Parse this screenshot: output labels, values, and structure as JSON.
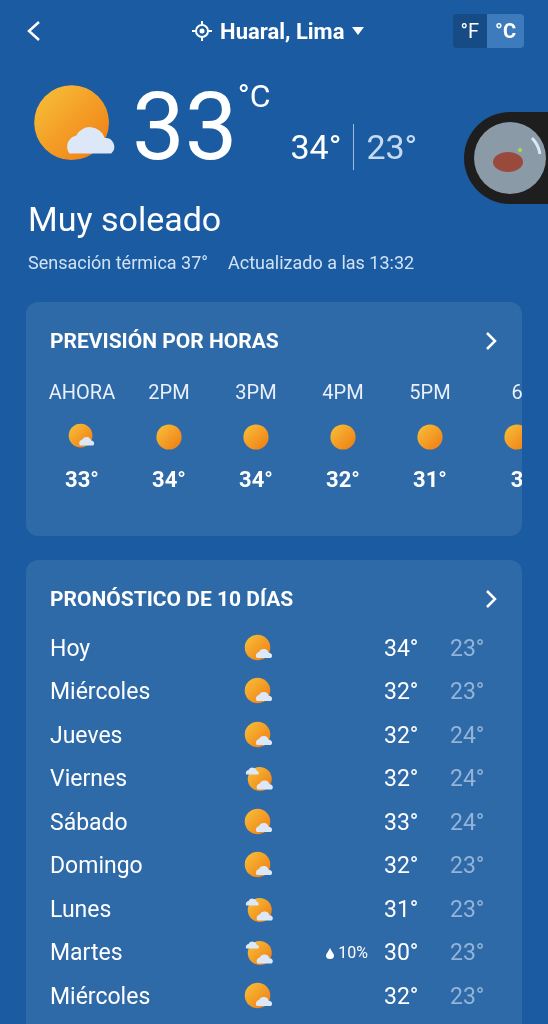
{
  "header": {
    "location": "Huaral, Lima",
    "units": [
      {
        "label": "°F",
        "selected": false
      },
      {
        "label": "°C",
        "selected": true
      }
    ]
  },
  "current": {
    "kind": "sun-cloud",
    "temp": "33",
    "unit": "°C",
    "high": "34°",
    "low": "23°",
    "condition": "Muy soleado",
    "feels_like": "Sensación térmica 37°",
    "updated": "Actualizado a las 13:32"
  },
  "hourly": {
    "title": "PREVISIÓN POR HORAS",
    "items": [
      {
        "time": "AHORA",
        "kind": "sun-cloud",
        "temp": "33°"
      },
      {
        "time": "2PM",
        "kind": "sun",
        "temp": "34°"
      },
      {
        "time": "3PM",
        "kind": "sun",
        "temp": "34°"
      },
      {
        "time": "4PM",
        "kind": "sun",
        "temp": "32°"
      },
      {
        "time": "5PM",
        "kind": "sun",
        "temp": "31°"
      },
      {
        "time": "6",
        "kind": "sun",
        "temp": "3"
      }
    ]
  },
  "daily": {
    "title": "PRONÓSTICO DE 10 DÍAS",
    "items": [
      {
        "day": "Hoy",
        "kind": "sun-cloud",
        "high": "34°",
        "low": "23°"
      },
      {
        "day": "Miércoles",
        "kind": "sun-cloud",
        "high": "32°",
        "low": "23°"
      },
      {
        "day": "Jueves",
        "kind": "sun-cloud",
        "high": "32°",
        "low": "24°"
      },
      {
        "day": "Viernes",
        "kind": "cloudy-sun",
        "high": "32°",
        "low": "24°"
      },
      {
        "day": "Sábado",
        "kind": "sun-cloud",
        "high": "33°",
        "low": "24°"
      },
      {
        "day": "Domingo",
        "kind": "sun-cloud",
        "high": "32°",
        "low": "23°"
      },
      {
        "day": "Lunes",
        "kind": "cloudy-sun",
        "high": "31°",
        "low": "23°"
      },
      {
        "day": "Martes",
        "kind": "cloudy-sun",
        "rain": "10%",
        "high": "30°",
        "low": "23°"
      },
      {
        "day": "Miércoles",
        "kind": "sun-cloud",
        "high": "32°",
        "low": "23°"
      }
    ]
  }
}
